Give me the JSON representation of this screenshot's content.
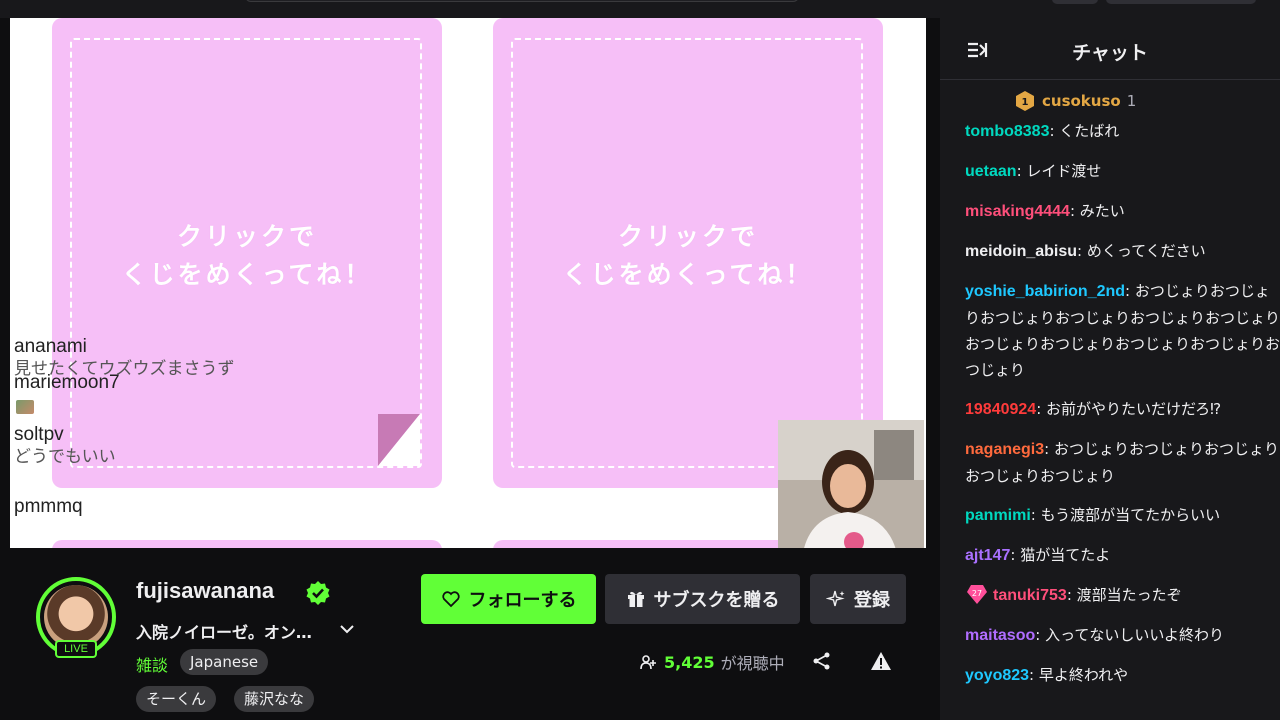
{
  "player": {
    "card_text": "クリックで\nくじをめくってね！",
    "overlay_chat": [
      {
        "name": "ananami",
        "message": "見せたくてウズウズまさうず"
      },
      {
        "name": "mariemoon7",
        "message": ""
      },
      {
        "name": "soltpv",
        "message": "どうでもいい"
      },
      {
        "name": "pmmmq",
        "message": ""
      }
    ]
  },
  "channel": {
    "name": "fujisawanana",
    "live_label": "LIVE",
    "title": "入院ノイローゼ。オン…",
    "category": "雑談",
    "tags": [
      "Japanese",
      "そーくん",
      "藤沢なな"
    ],
    "follow_label": "フォローする",
    "gift_label": "サブスクを贈る",
    "subscribe_label": "登録",
    "viewer_count": "5,425",
    "viewer_suffix": "が視聴中"
  },
  "chat": {
    "title": "チャット",
    "pinned": {
      "rank": "1",
      "name": "cusokuso",
      "count": "1"
    },
    "messages": [
      {
        "user": "tombo8383",
        "color": "#00d9c0",
        "text": "くたばれ"
      },
      {
        "user": "uetaan",
        "color": "#00d9c0",
        "text": "レイド渡せ"
      },
      {
        "user": "misaking4444",
        "color": "#ff4f7b",
        "text": "みたい"
      },
      {
        "user": "meidoin_abisu",
        "color": "#efeff1",
        "text": "めくってください"
      },
      {
        "user": "yoshie_babirion_2nd",
        "color": "#1ec8ff",
        "text": "おつじょりおつじょりおつじょりおつじょりおつじょりおつじょりおつじょりおつじょりおつじょりおつじょりおつじょり"
      },
      {
        "user": "19840924",
        "color": "#ff3b3b",
        "text": "お前がやりたいだけだろ⁉"
      },
      {
        "user": "naganegi3",
        "color": "#ff6a3d",
        "text": "おつじょりおつじょりおつじょりおつじょりおつじょり"
      },
      {
        "user": "panmimi",
        "color": "#00d9c0",
        "text": "もう渡部が当てたからいい"
      },
      {
        "user": "ajt147",
        "color": "#a970ff",
        "text": "猫が当てたよ"
      },
      {
        "user": "tanuki753",
        "color": "#ff4f7b",
        "text": "渡部当たったぞ",
        "badge": "27"
      },
      {
        "user": "maitasoo",
        "color": "#b06dff",
        "text": "入ってないしいいよ終わり"
      },
      {
        "user": "yoyo823",
        "color": "#1ec8ff",
        "text": "早よ終われや"
      }
    ]
  }
}
